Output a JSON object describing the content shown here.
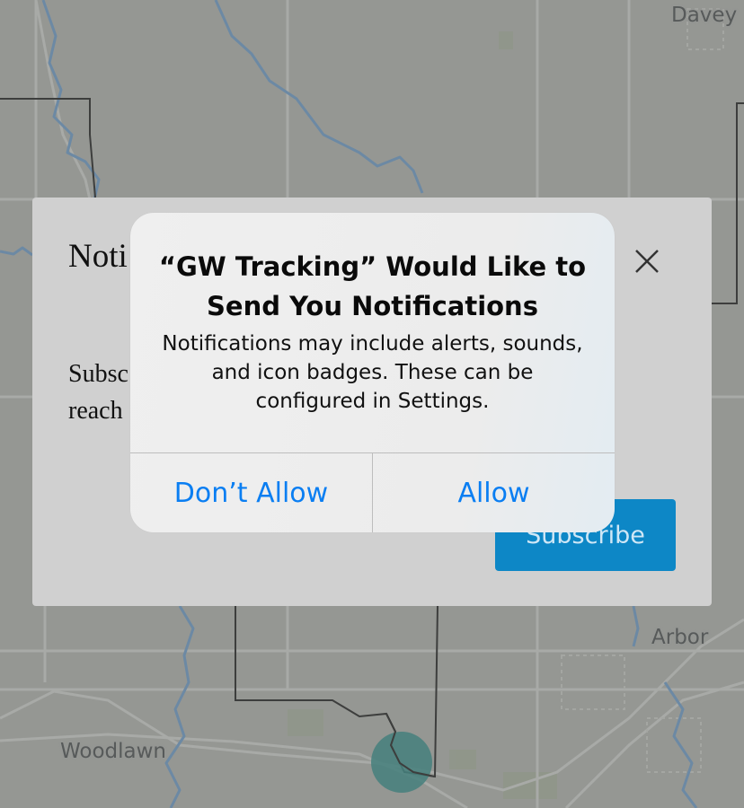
{
  "map": {
    "place_labels": [
      "Davey",
      "Arbor",
      "Woodlawn"
    ]
  },
  "sheet": {
    "title_fragment": "Noti",
    "body_fragment_line1": "Subsc",
    "body_fragment_line2": "reach",
    "subscribe_label": "Subscribe",
    "close_icon": "close-icon"
  },
  "alert": {
    "title": "“GW Tracking” Would Like to Send You Notifications",
    "message": "Notifications may include alerts, sounds, and icon badges. These can be configured in Settings.",
    "dont_allow_label": "Don’t Allow",
    "allow_label": "Allow"
  },
  "colors": {
    "map_background": "#b5b7b2",
    "water": "#6f9fcf",
    "road": "#d6d7d4",
    "boundary": "#1e1e1e",
    "location_marker": "#2c8f8b",
    "subscribe_button": "#0d87c6",
    "alert_button_text": "#0a7ef2"
  }
}
